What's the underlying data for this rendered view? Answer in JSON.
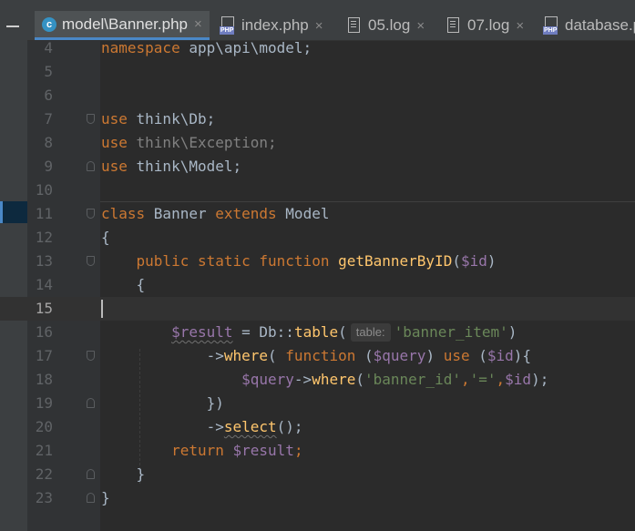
{
  "tabs": [
    {
      "label": "model\\Banner.php",
      "icon": "php-class-icon",
      "active": true
    },
    {
      "label": "index.php",
      "icon": "php-file-icon",
      "active": false
    },
    {
      "label": "05.log",
      "icon": "log-file-icon",
      "active": false
    },
    {
      "label": "07.log",
      "icon": "log-file-icon",
      "active": false
    },
    {
      "label": "database.p",
      "icon": "php-file-icon",
      "active": false
    }
  ],
  "tab_close_glyph": "×",
  "current_line": 15,
  "lines": [
    {
      "n": "4",
      "seg": [
        [
          "kw",
          "namespace "
        ],
        [
          "",
          "app\\api\\model;"
        ]
      ]
    },
    {
      "n": "5",
      "seg": []
    },
    {
      "n": "6",
      "seg": []
    },
    {
      "n": "7",
      "seg": [
        [
          "kw",
          "use "
        ],
        [
          "",
          "think\\Db;"
        ]
      ]
    },
    {
      "n": "8",
      "seg": [
        [
          "kw",
          "use "
        ],
        [
          "gray",
          "think\\Exception;"
        ]
      ]
    },
    {
      "n": "9",
      "seg": [
        [
          "kw",
          "use "
        ],
        [
          "",
          "think\\Model;"
        ]
      ]
    },
    {
      "n": "10",
      "seg": []
    },
    {
      "n": "11",
      "seg": [
        [
          "kw",
          "class "
        ],
        [
          "",
          "Banner "
        ],
        [
          "kw",
          "extends "
        ],
        [
          "",
          "Model"
        ]
      ]
    },
    {
      "n": "12",
      "seg": [
        [
          "",
          "{"
        ]
      ]
    },
    {
      "n": "13",
      "seg": [
        [
          "",
          "    "
        ],
        [
          "kw",
          "public static function "
        ],
        [
          "fn",
          "getBannerByID"
        ],
        [
          "",
          "("
        ],
        [
          "var",
          "$id"
        ],
        [
          "",
          ")"
        ]
      ]
    },
    {
      "n": "14",
      "seg": [
        [
          "",
          "    {"
        ]
      ]
    },
    {
      "n": "15",
      "seg": []
    },
    {
      "n": "16",
      "seg": [
        [
          "",
          "        "
        ],
        [
          "var sq",
          "$result"
        ],
        [
          "",
          " = Db::"
        ],
        [
          "fn",
          "table"
        ],
        [
          "",
          "("
        ],
        [
          "hint",
          "table:"
        ],
        [
          "str",
          "'banner_item'"
        ],
        [
          "",
          ")"
        ]
      ]
    },
    {
      "n": "17",
      "seg": [
        [
          "",
          "            ->"
        ],
        [
          "fn",
          "where"
        ],
        [
          "",
          "( "
        ],
        [
          "kw",
          "function "
        ],
        [
          "",
          "("
        ],
        [
          "var",
          "$query"
        ],
        [
          ") "
        ],
        [
          "kw",
          "use "
        ],
        [
          "",
          "("
        ],
        [
          "var",
          "$id"
        ],
        [
          "",
          "){"
        ]
      ]
    },
    {
      "n": "18",
      "seg": [
        [
          "",
          "                "
        ],
        [
          "var",
          "$query"
        ],
        [
          "",
          "->"
        ],
        [
          "fn",
          "where"
        ],
        [
          "",
          "("
        ],
        [
          "str",
          "'banner_id'"
        ],
        [
          "kw",
          ","
        ],
        [
          "str",
          "'='"
        ],
        [
          "kw",
          ","
        ],
        [
          "var",
          "$id"
        ],
        [
          "",
          ");"
        ]
      ]
    },
    {
      "n": "19",
      "seg": [
        [
          "",
          "            })"
        ]
      ]
    },
    {
      "n": "20",
      "seg": [
        [
          "",
          "            ->"
        ],
        [
          "fn sq",
          "select"
        ],
        [
          "",
          "();"
        ]
      ]
    },
    {
      "n": "21",
      "seg": [
        [
          "",
          "        "
        ],
        [
          "kw",
          "return "
        ],
        [
          "var",
          "$result"
        ],
        [
          "kw",
          ";"
        ]
      ]
    },
    {
      "n": "22",
      "seg": [
        [
          "",
          "    }"
        ]
      ]
    },
    {
      "n": "23",
      "seg": [
        [
          "",
          "}"
        ]
      ]
    }
  ],
  "folds": {
    "7": "down",
    "9": "up",
    "11": "down",
    "13": "down",
    "17": "down",
    "19": "up",
    "22": "up",
    "23": "up"
  },
  "colors": {
    "keyword": "#cc7832",
    "variable": "#9876aa",
    "string": "#6a8759",
    "function": "#ffc66d",
    "text": "#a9b7c6",
    "background": "#2b2b2b"
  }
}
